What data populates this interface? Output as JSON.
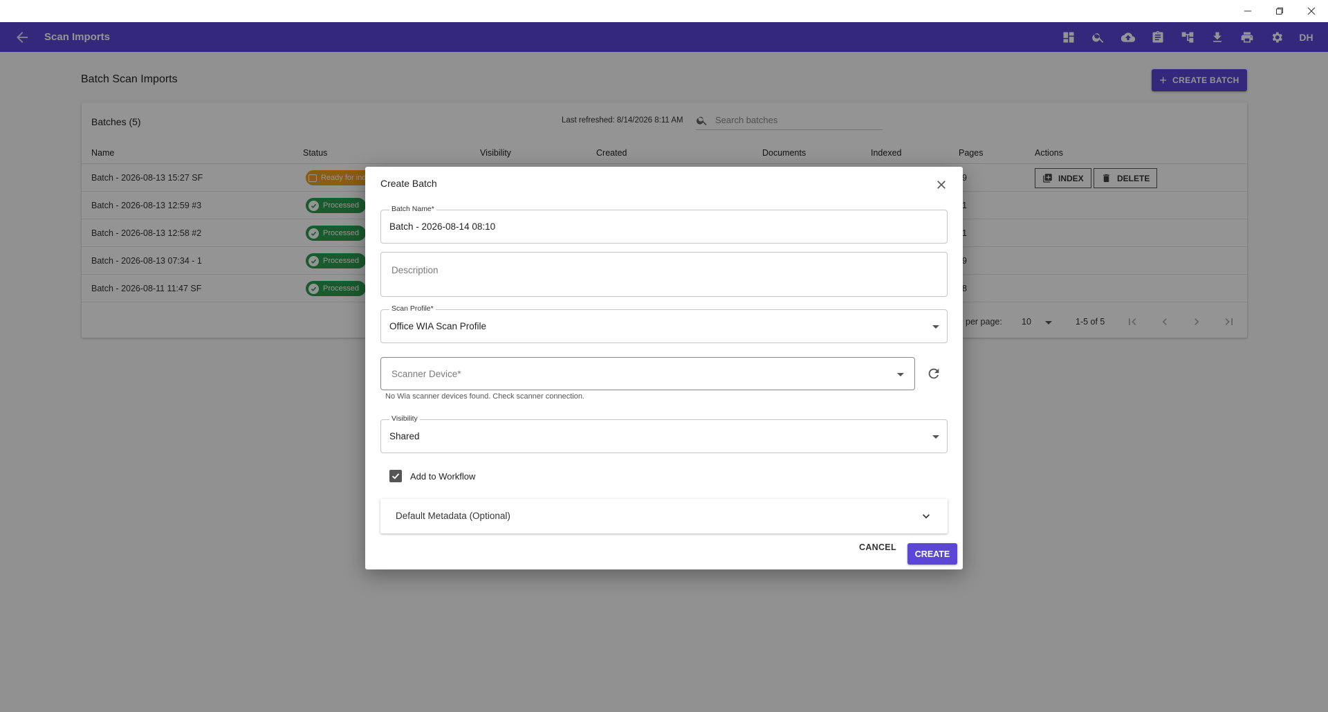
{
  "app": {
    "title": "Scan Imports",
    "avatar": "DH",
    "accent": "#5b46d8",
    "toolbar_icons": [
      "dashboard-icon",
      "search-icon",
      "cloud-upload-icon",
      "clipboard-icon",
      "hierarchy-icon",
      "download-icon",
      "print-icon",
      "settings-icon"
    ]
  },
  "page": {
    "title": "Batch Scan Imports",
    "create_batch_label": "CREATE BATCH"
  },
  "table": {
    "title": "Batches (5)",
    "last_refreshed": "Last refreshed: 8/14/2026 8:11 AM",
    "search_placeholder": "Search batches",
    "columns": {
      "name": "Name",
      "status": "Status",
      "visibility": "Visibility",
      "created": "Created",
      "documents": "Documents",
      "indexed": "Indexed",
      "pages": "Pages",
      "actions": "Actions"
    },
    "rows": [
      {
        "name": "Batch - 2026-08-13 15:27 SF",
        "status": "Ready for ind",
        "pages": "9"
      },
      {
        "name": "Batch - 2026-08-13 12:59 #3",
        "status": "Processed",
        "pages": "1"
      },
      {
        "name": "Batch - 2026-08-13 12:58 #2",
        "status": "Processed",
        "pages": "1"
      },
      {
        "name": "Batch - 2026-08-13 07:34 - 1",
        "status": "Processed",
        "pages": "9"
      },
      {
        "name": "Batch - 2026-08-11 11:47 SF",
        "status": "Processed",
        "pages": "8"
      }
    ],
    "actions": {
      "index": "INDEX",
      "delete": "DELETE"
    },
    "pager": {
      "rows_label": "per page:",
      "rows_value": "10",
      "range": "1-5 of 5"
    }
  },
  "dialog": {
    "title": "Create Batch",
    "batch_name": {
      "label": "Batch Name*",
      "value": "Batch - 2026-08-14 08:10"
    },
    "description": {
      "placeholder": "Description"
    },
    "scan_profile": {
      "label": "Scan Profile*",
      "value": "Office WIA Scan Profile"
    },
    "scanner_device": {
      "placeholder": "Scanner Device*",
      "helper": "No Wia scanner devices found. Check scanner connection."
    },
    "visibility": {
      "label": "Visibility",
      "value": "Shared"
    },
    "add_to_workflow": {
      "label": "Add to Workflow",
      "checked": true
    },
    "default_metadata": "Default Metadata (Optional)",
    "cancel_label": "CANCEL",
    "create_label": "CREATE"
  }
}
